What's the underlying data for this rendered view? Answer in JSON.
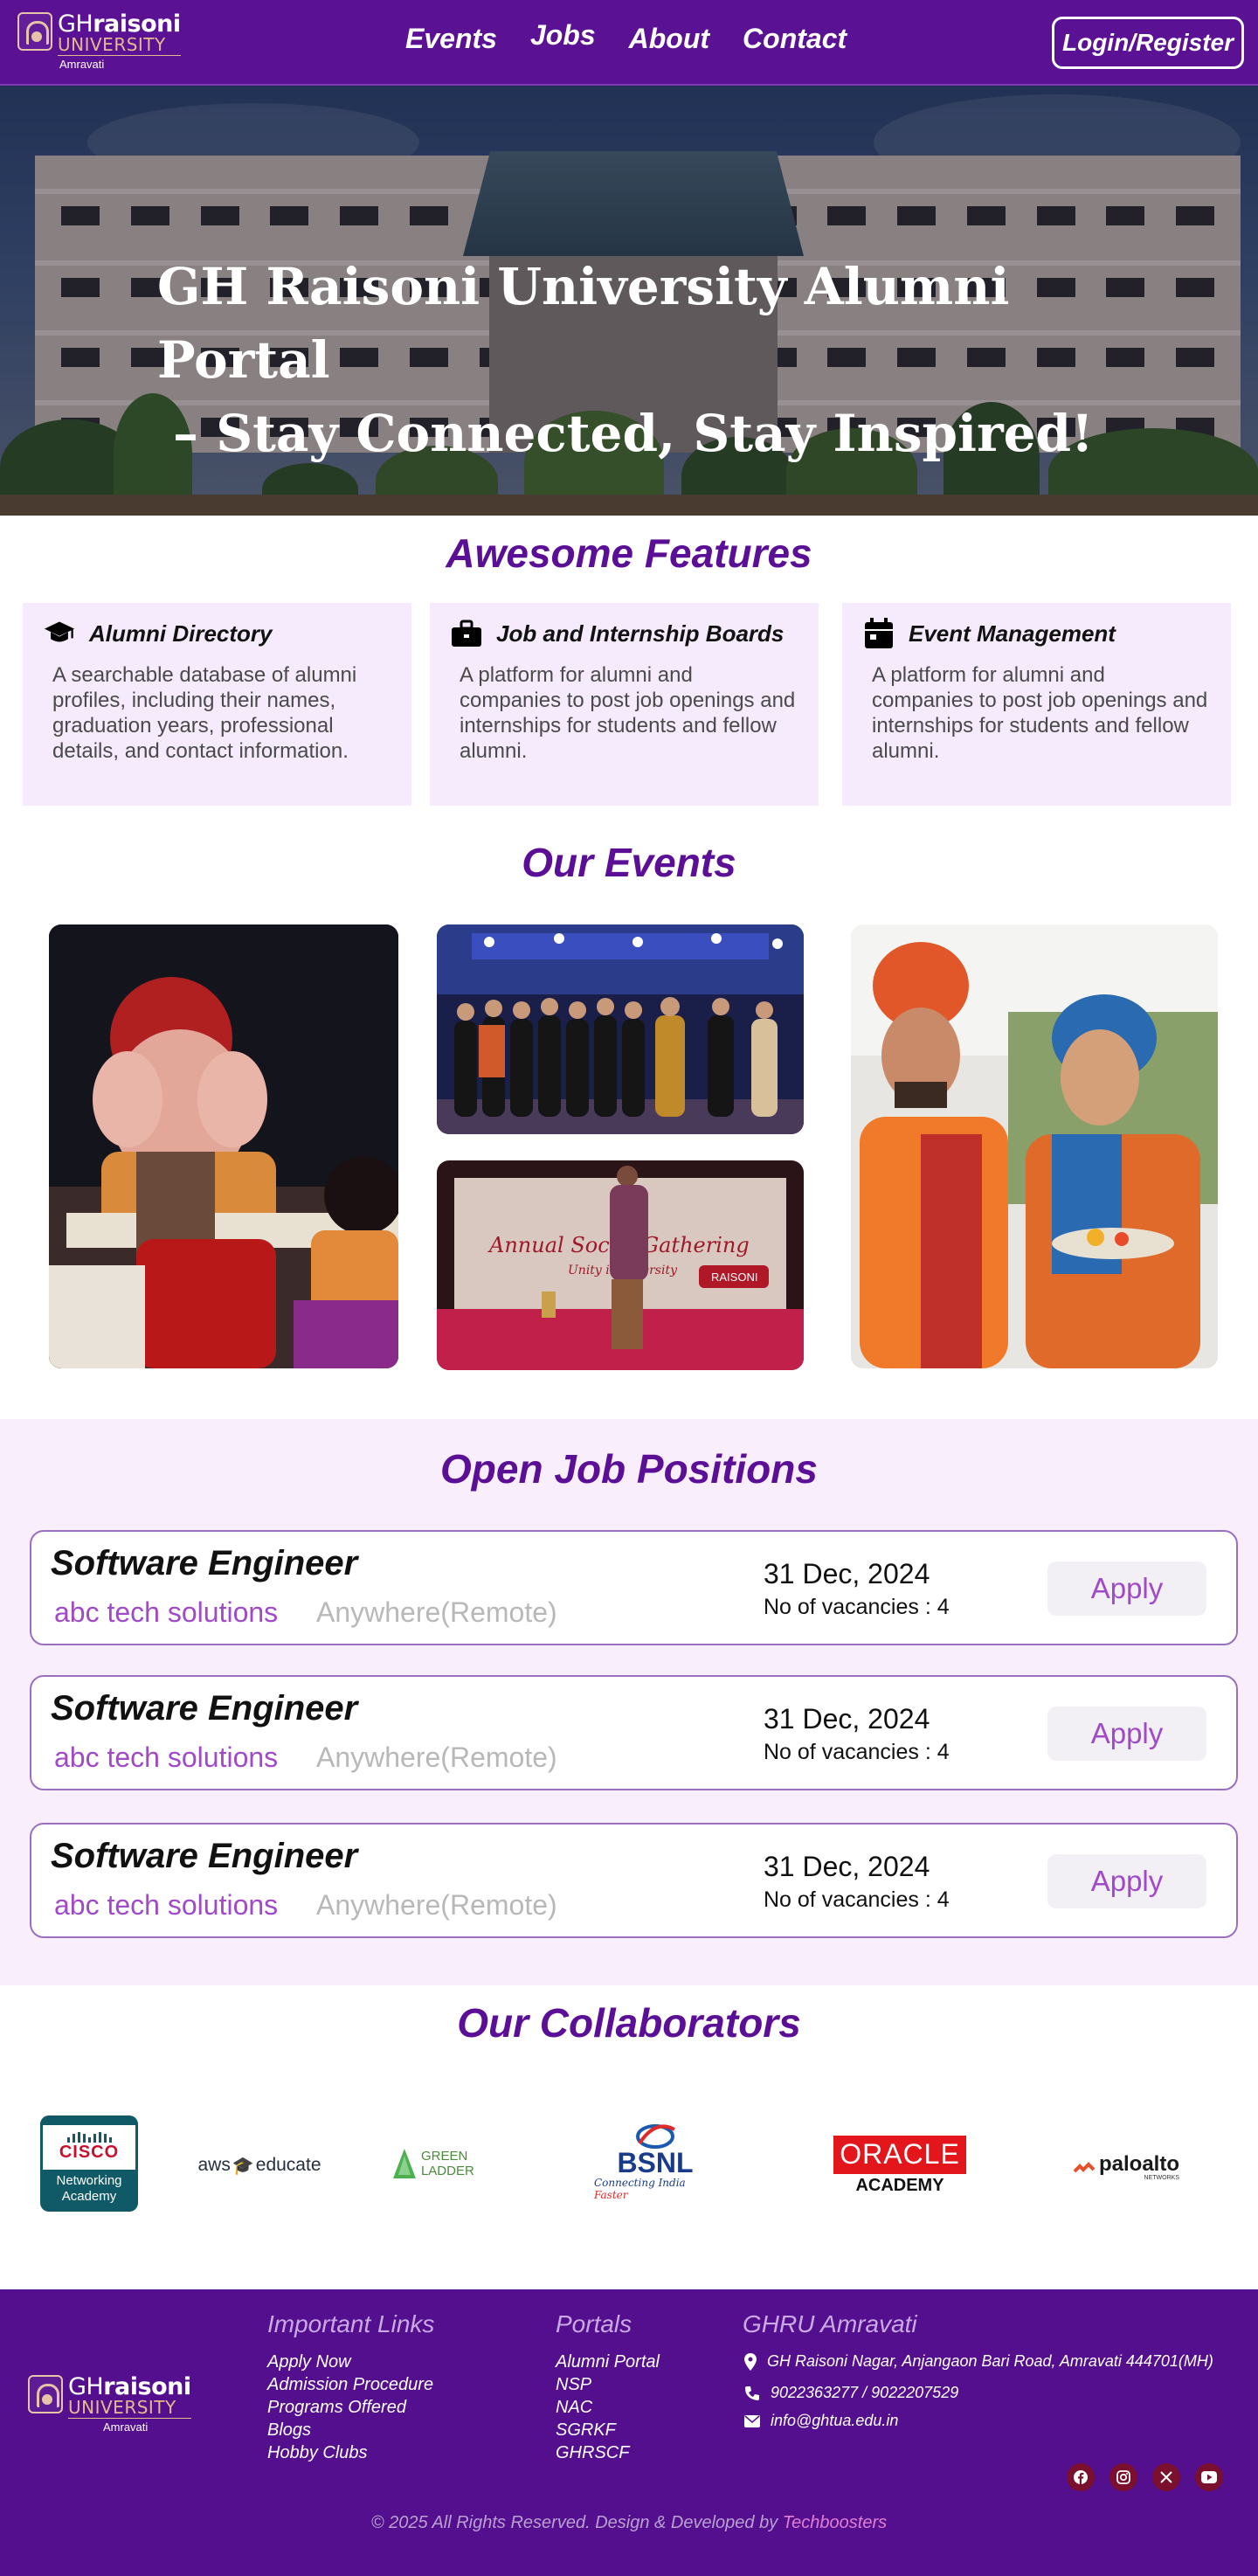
{
  "nav": {
    "logo": {
      "gh": "GH",
      "raisoni": "raisoni",
      "university": "UNIVERSITY",
      "city": "Amravati"
    },
    "links": [
      "Events",
      "Jobs",
      "About",
      "Contact"
    ],
    "login_label": "Login/Register"
  },
  "hero": {
    "title_line1": "GH Raisoni University Alumni Portal",
    "title_line2": "– Stay Connected, Stay Inspired!"
  },
  "features": {
    "heading": "Awesome Features",
    "items": [
      {
        "icon": "graduation-cap-icon",
        "title": "Alumni Directory",
        "desc": "A searchable database of alumni profiles, including their names, graduation years, professional details, and contact information."
      },
      {
        "icon": "briefcase-icon",
        "title": "Job and Internship Boards",
        "desc": "A platform for alumni and companies to post job openings and internships for students and fellow alumni."
      },
      {
        "icon": "calendar-icon",
        "title": "Event Management",
        "desc": "A platform for alumni and companies to post job openings and internships for students and fellow alumni."
      }
    ]
  },
  "events": {
    "heading": "Our Events",
    "photos": [
      "ganesh-idol-photo",
      "award-ceremony-photo",
      "annual-social-gathering-photo",
      "traditional-couple-photo"
    ],
    "stage_banner_text": "Annual Social Gathering",
    "stage_banner_sub": "Unity in Diversity",
    "stage_banner_brand": "RAISONI"
  },
  "jobs": {
    "heading": "Open Job Positions",
    "items": [
      {
        "title": "Software Engineer",
        "company": "abc tech solutions",
        "location": "Anywhere(Remote)",
        "date": "31 Dec, 2024",
        "vacancies": "No of vacancies : 4",
        "apply": "Apply"
      },
      {
        "title": "Software Engineer",
        "company": "abc tech solutions",
        "location": "Anywhere(Remote)",
        "date": "31 Dec, 2024",
        "vacancies": "No of vacancies : 4",
        "apply": "Apply"
      },
      {
        "title": "Software Engineer",
        "company": "abc tech solutions",
        "location": "Anywhere(Remote)",
        "date": "31 Dec, 2024",
        "vacancies": "No of vacancies : 4",
        "apply": "Apply"
      }
    ]
  },
  "collaborators": {
    "heading": "Our Collaborators",
    "cisco": {
      "brand": "CISCO",
      "line1": "Networking",
      "line2": "Academy"
    },
    "aws": {
      "a": "aws",
      "b": "educate"
    },
    "greenladder": {
      "name": "GREEN LADDER"
    },
    "bsnl": {
      "name": "BSNL",
      "tag": "Connecting India",
      "tag2": "Faster"
    },
    "oracle": {
      "name": "ORACLE",
      "sub": "ACADEMY"
    },
    "paloalto": {
      "name": "paloalto",
      "sub": "NETWORKS"
    }
  },
  "footer": {
    "logo": {
      "gh": "GH",
      "raisoni": "raisoni",
      "university": "UNIVERSITY",
      "city": "Amravati"
    },
    "important_heading": "Important Links",
    "important_links": [
      "Apply Now",
      "Admission Procedure",
      "Programs Offered",
      "Blogs",
      "Hobby Clubs"
    ],
    "portals_heading": "Portals",
    "portals": [
      "Alumni Portal",
      "NSP",
      "NAC",
      "SGRKF",
      "GHRSCF"
    ],
    "contact_heading": "GHRU Amravati",
    "address": "GH Raisoni Nagar, Anjangaon Bari Road, Amravati 444701(MH)",
    "phone": "9022363277 / 9022207529",
    "email": "info@ghtua.edu.in",
    "socials": [
      "facebook-icon",
      "instagram-icon",
      "x-icon",
      "youtube-icon"
    ],
    "copyright": "© 2025 All Rights Reserved. Design & Developed by",
    "developer": "Techboosters"
  },
  "colors": {
    "primary": "#5a1194",
    "accent": "#a049c9",
    "feature_bg": "#f6ebfd",
    "jobs_bg": "#f9eefc"
  }
}
